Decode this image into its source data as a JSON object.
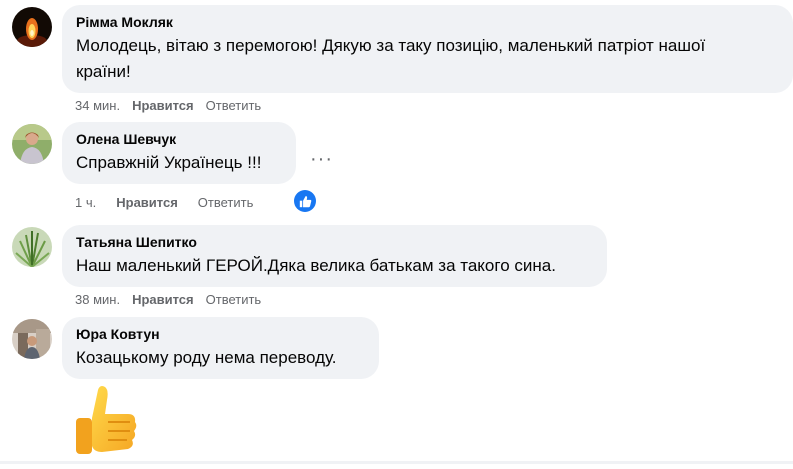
{
  "comments": [
    {
      "author": "Рімма Мокляк",
      "text_line1": "Молодець, вітаю з перемогою! Дякую за таку позицію, маленький патріот нашої",
      "text_line2": "країни!",
      "time": "34 мин.",
      "like": "Нравится",
      "reply": "Ответить"
    },
    {
      "author": "Олена Шевчук",
      "text_line1": "Справжній Українець !!!",
      "time": "1 ч.",
      "like": "Нравится",
      "reply": "Ответить",
      "more": "···",
      "reaction": "like"
    },
    {
      "author": "Татьяна Шепитко",
      "text_line1": "Наш маленький ГЕРОЙ.Дяка велика батькам за такого сина.",
      "time": "38 мин.",
      "like": "Нравится",
      "reply": "Ответить"
    },
    {
      "author": "Юра Ковтун",
      "text_line1": "Козацькому роду нема переводу.",
      "sticker": "thumbs-up"
    }
  ],
  "colors": {
    "bubble": "#f0f2f5",
    "meta": "#65676b",
    "like_blue": "#1877f2"
  }
}
